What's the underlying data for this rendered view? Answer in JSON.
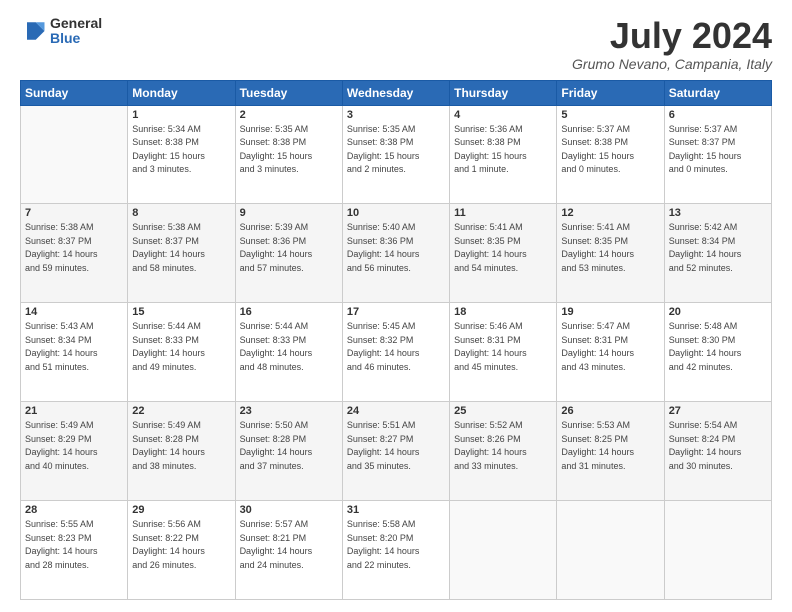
{
  "header": {
    "logo_general": "General",
    "logo_blue": "Blue",
    "month_year": "July 2024",
    "location": "Grumo Nevano, Campania, Italy"
  },
  "weekdays": [
    "Sunday",
    "Monday",
    "Tuesday",
    "Wednesday",
    "Thursday",
    "Friday",
    "Saturday"
  ],
  "weeks": [
    [
      {
        "day": "",
        "info": ""
      },
      {
        "day": "1",
        "info": "Sunrise: 5:34 AM\nSunset: 8:38 PM\nDaylight: 15 hours\nand 3 minutes."
      },
      {
        "day": "2",
        "info": "Sunrise: 5:35 AM\nSunset: 8:38 PM\nDaylight: 15 hours\nand 3 minutes."
      },
      {
        "day": "3",
        "info": "Sunrise: 5:35 AM\nSunset: 8:38 PM\nDaylight: 15 hours\nand 2 minutes."
      },
      {
        "day": "4",
        "info": "Sunrise: 5:36 AM\nSunset: 8:38 PM\nDaylight: 15 hours\nand 1 minute."
      },
      {
        "day": "5",
        "info": "Sunrise: 5:37 AM\nSunset: 8:38 PM\nDaylight: 15 hours\nand 0 minutes."
      },
      {
        "day": "6",
        "info": "Sunrise: 5:37 AM\nSunset: 8:37 PM\nDaylight: 15 hours\nand 0 minutes."
      }
    ],
    [
      {
        "day": "7",
        "info": "Sunrise: 5:38 AM\nSunset: 8:37 PM\nDaylight: 14 hours\nand 59 minutes."
      },
      {
        "day": "8",
        "info": "Sunrise: 5:38 AM\nSunset: 8:37 PM\nDaylight: 14 hours\nand 58 minutes."
      },
      {
        "day": "9",
        "info": "Sunrise: 5:39 AM\nSunset: 8:36 PM\nDaylight: 14 hours\nand 57 minutes."
      },
      {
        "day": "10",
        "info": "Sunrise: 5:40 AM\nSunset: 8:36 PM\nDaylight: 14 hours\nand 56 minutes."
      },
      {
        "day": "11",
        "info": "Sunrise: 5:41 AM\nSunset: 8:35 PM\nDaylight: 14 hours\nand 54 minutes."
      },
      {
        "day": "12",
        "info": "Sunrise: 5:41 AM\nSunset: 8:35 PM\nDaylight: 14 hours\nand 53 minutes."
      },
      {
        "day": "13",
        "info": "Sunrise: 5:42 AM\nSunset: 8:34 PM\nDaylight: 14 hours\nand 52 minutes."
      }
    ],
    [
      {
        "day": "14",
        "info": "Sunrise: 5:43 AM\nSunset: 8:34 PM\nDaylight: 14 hours\nand 51 minutes."
      },
      {
        "day": "15",
        "info": "Sunrise: 5:44 AM\nSunset: 8:33 PM\nDaylight: 14 hours\nand 49 minutes."
      },
      {
        "day": "16",
        "info": "Sunrise: 5:44 AM\nSunset: 8:33 PM\nDaylight: 14 hours\nand 48 minutes."
      },
      {
        "day": "17",
        "info": "Sunrise: 5:45 AM\nSunset: 8:32 PM\nDaylight: 14 hours\nand 46 minutes."
      },
      {
        "day": "18",
        "info": "Sunrise: 5:46 AM\nSunset: 8:31 PM\nDaylight: 14 hours\nand 45 minutes."
      },
      {
        "day": "19",
        "info": "Sunrise: 5:47 AM\nSunset: 8:31 PM\nDaylight: 14 hours\nand 43 minutes."
      },
      {
        "day": "20",
        "info": "Sunrise: 5:48 AM\nSunset: 8:30 PM\nDaylight: 14 hours\nand 42 minutes."
      }
    ],
    [
      {
        "day": "21",
        "info": "Sunrise: 5:49 AM\nSunset: 8:29 PM\nDaylight: 14 hours\nand 40 minutes."
      },
      {
        "day": "22",
        "info": "Sunrise: 5:49 AM\nSunset: 8:28 PM\nDaylight: 14 hours\nand 38 minutes."
      },
      {
        "day": "23",
        "info": "Sunrise: 5:50 AM\nSunset: 8:28 PM\nDaylight: 14 hours\nand 37 minutes."
      },
      {
        "day": "24",
        "info": "Sunrise: 5:51 AM\nSunset: 8:27 PM\nDaylight: 14 hours\nand 35 minutes."
      },
      {
        "day": "25",
        "info": "Sunrise: 5:52 AM\nSunset: 8:26 PM\nDaylight: 14 hours\nand 33 minutes."
      },
      {
        "day": "26",
        "info": "Sunrise: 5:53 AM\nSunset: 8:25 PM\nDaylight: 14 hours\nand 31 minutes."
      },
      {
        "day": "27",
        "info": "Sunrise: 5:54 AM\nSunset: 8:24 PM\nDaylight: 14 hours\nand 30 minutes."
      }
    ],
    [
      {
        "day": "28",
        "info": "Sunrise: 5:55 AM\nSunset: 8:23 PM\nDaylight: 14 hours\nand 28 minutes."
      },
      {
        "day": "29",
        "info": "Sunrise: 5:56 AM\nSunset: 8:22 PM\nDaylight: 14 hours\nand 26 minutes."
      },
      {
        "day": "30",
        "info": "Sunrise: 5:57 AM\nSunset: 8:21 PM\nDaylight: 14 hours\nand 24 minutes."
      },
      {
        "day": "31",
        "info": "Sunrise: 5:58 AM\nSunset: 8:20 PM\nDaylight: 14 hours\nand 22 minutes."
      },
      {
        "day": "",
        "info": ""
      },
      {
        "day": "",
        "info": ""
      },
      {
        "day": "",
        "info": ""
      }
    ]
  ]
}
